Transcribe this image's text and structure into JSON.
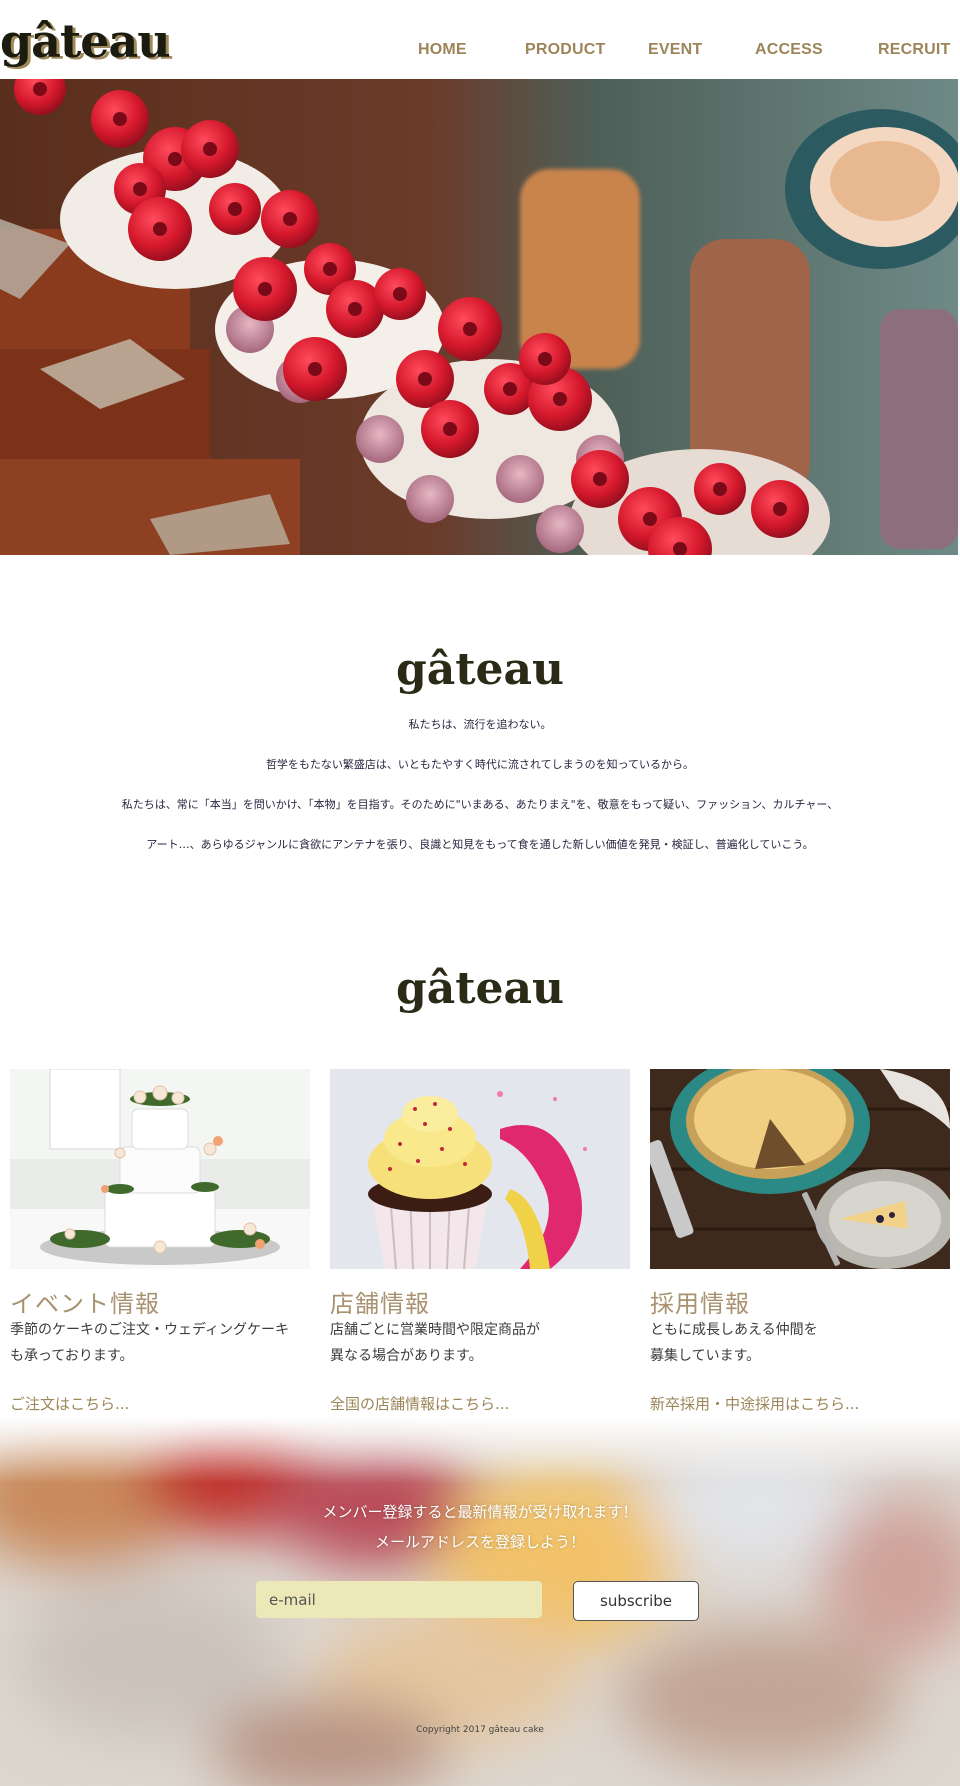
{
  "header": {
    "logo": "gâteau",
    "nav": [
      "HOME",
      "PRODUCT",
      "EVENT",
      "ACCESS",
      "RECRUIT"
    ]
  },
  "about": {
    "logo": "gâteau",
    "lines": [
      "私たちは、流行を追わない。",
      "哲学をもたない繁盛店は、いともたやすく時代に流されてしまうのを知っているから。",
      "私たちは、常に「本当」を問いかけ、「本物」を目指す。そのために\"いまある、あたりまえ\"を、敬意をもって疑い、ファッション、カルチャー、",
      "アート…、あらゆるジャンルに貪欲にアンテナを張り、良識と知見をもって食を通した新しい価値を発見・検証し、普遍化していこう。"
    ]
  },
  "products": {
    "logo": "gâteau",
    "cards": [
      {
        "title": "イベント情報",
        "desc": "季節のケーキのご注文・ウェディングケーキ\nも承っております。",
        "link": "ご注文はこちら..."
      },
      {
        "title": "店舗情報",
        "desc": "店舗ごとに営業時間や限定商品が\n異なる場合があります。",
        "link": "全国の店舗情報はこちら..."
      },
      {
        "title": "採用情報",
        "desc": "ともに成長しあえる仲間を\n募集しています。",
        "link": "新卒採用・中途採用はこちら..."
      }
    ]
  },
  "newsletter": {
    "line1": "メンバー登録すると最新情報が受け取れます！",
    "line2": "メールアドレスを登録しよう！",
    "email_placeholder": "e-mail",
    "subscribe_label": "subscribe",
    "copyright": "Copyright 2017  gâteau cake"
  },
  "colors": {
    "nav": "#9c8559",
    "title_accent": "#a89270",
    "input_bg": "#ece8b8"
  }
}
